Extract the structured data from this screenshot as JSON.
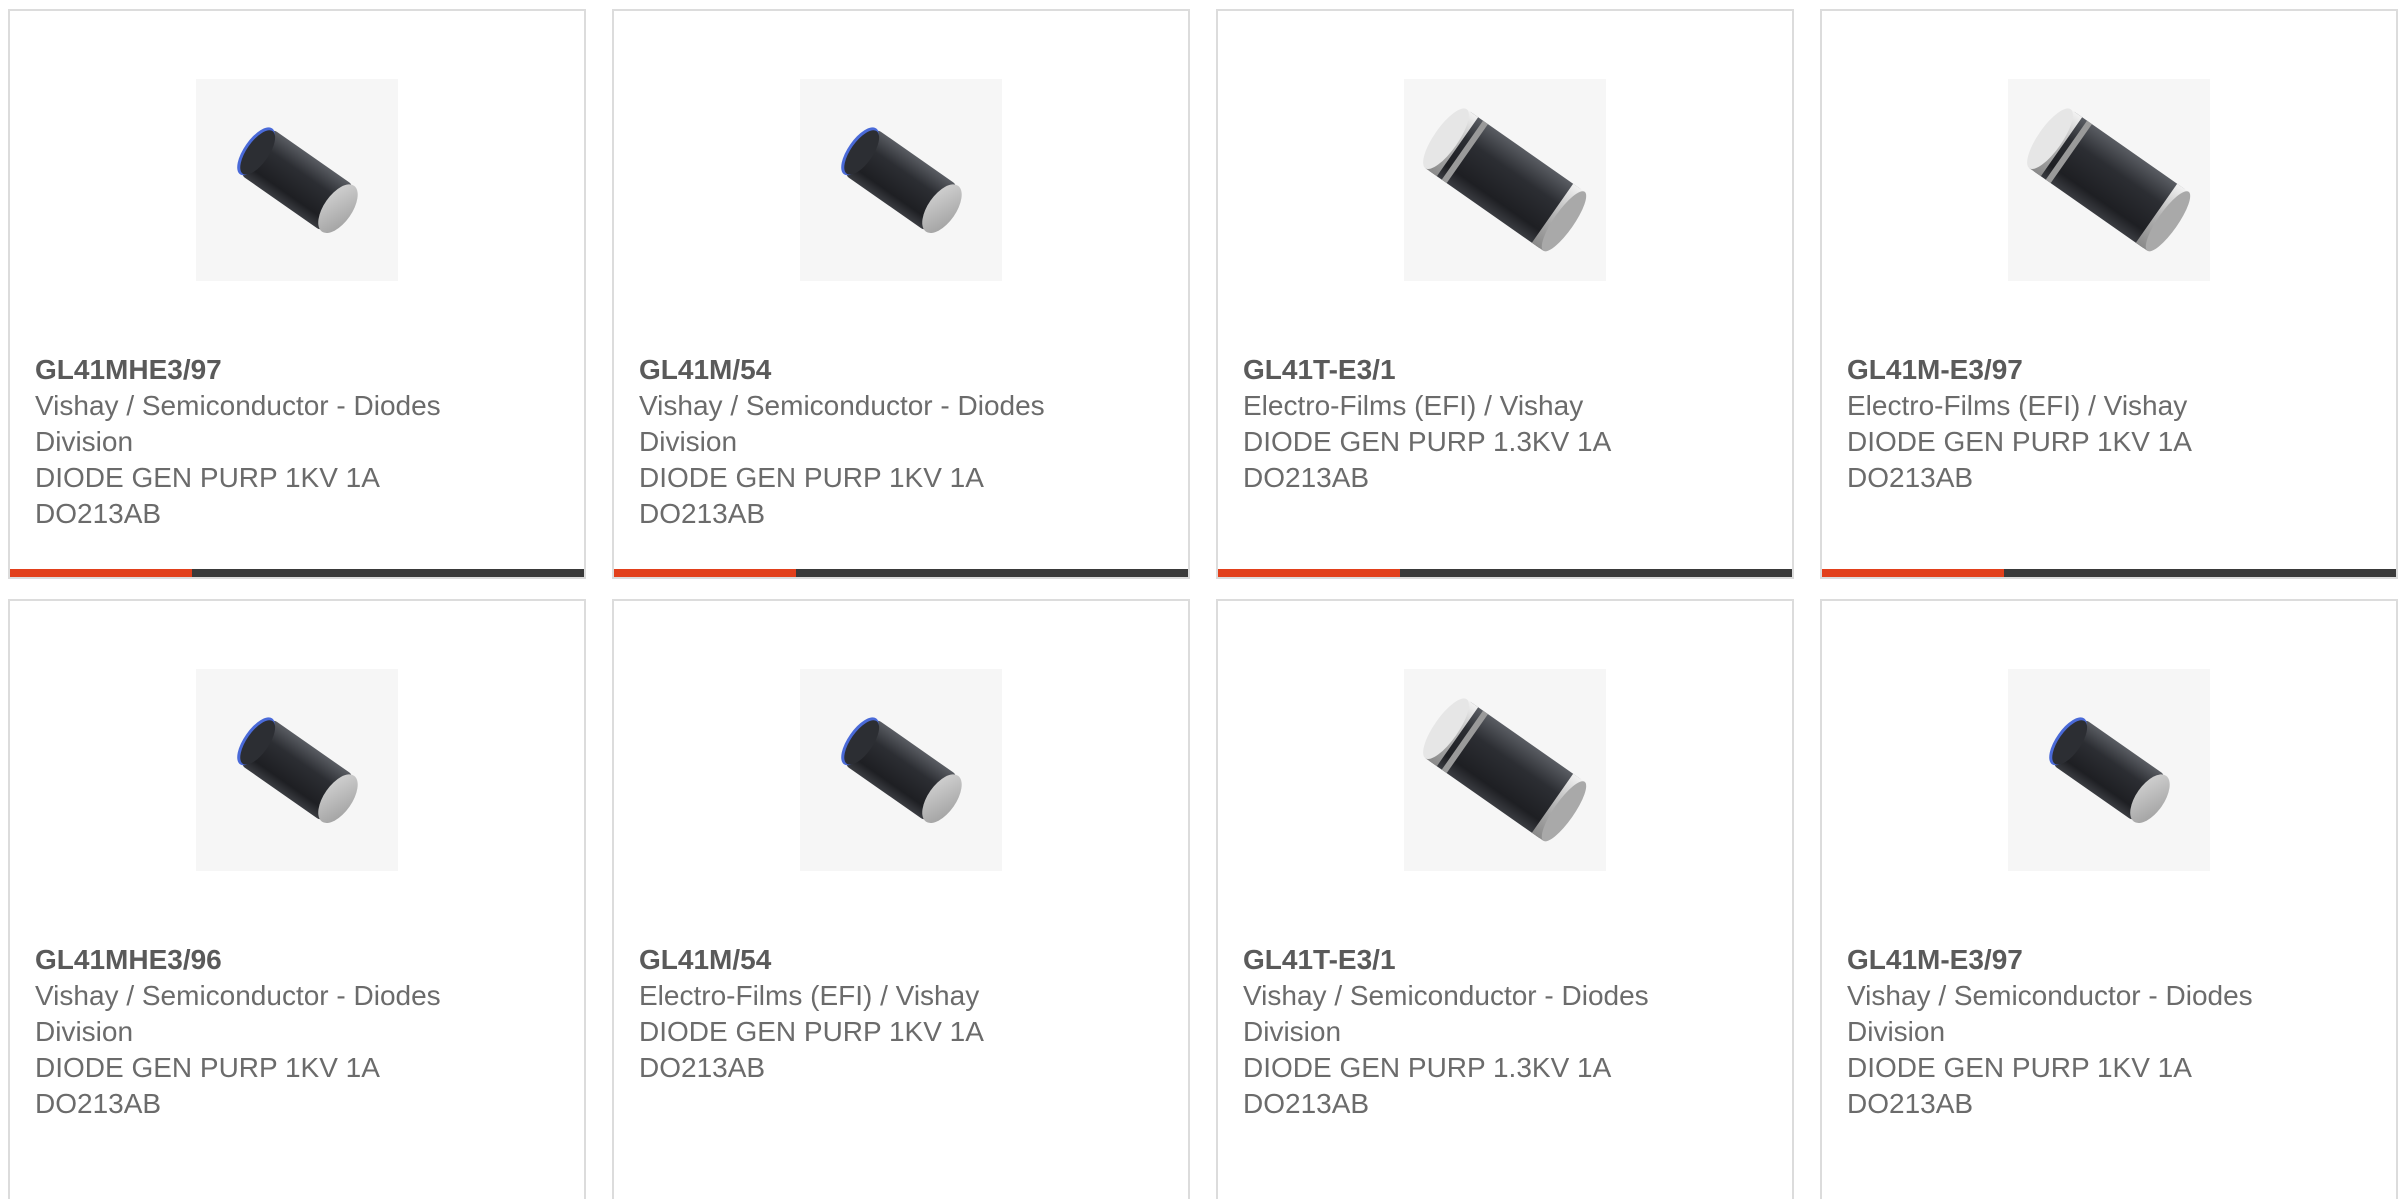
{
  "colors": {
    "accent": "#e2401c",
    "bar": "#3a3a3a",
    "text": "#6b6b6b",
    "border": "#dcdcdc"
  },
  "products": [
    {
      "part": "GL41MHE3/97",
      "manufacturer": "Vishay / Semiconductor - Diodes Division",
      "description": "DIODE GEN PURP 1KV 1A DO213AB",
      "image_icon": "melf-diode-small-icon"
    },
    {
      "part": "GL41M/54",
      "manufacturer": "Vishay / Semiconductor - Diodes Division",
      "description": "DIODE GEN PURP 1KV 1A DO213AB",
      "image_icon": "melf-diode-small-icon"
    },
    {
      "part": "GL41T-E3/1",
      "manufacturer": "Electro-Films (EFI) / Vishay",
      "description": "DIODE GEN PURP 1.3KV 1A DO213AB",
      "image_icon": "melf-diode-large-icon"
    },
    {
      "part": "GL41M-E3/97",
      "manufacturer": "Electro-Films (EFI) / Vishay",
      "description": "DIODE GEN PURP 1KV 1A DO213AB",
      "image_icon": "melf-diode-large-icon"
    },
    {
      "part": "GL41MHE3/96",
      "manufacturer": "Vishay / Semiconductor - Diodes Division",
      "description": "DIODE GEN PURP 1KV 1A DO213AB",
      "image_icon": "melf-diode-small-icon"
    },
    {
      "part": "GL41M/54",
      "manufacturer": "Electro-Films (EFI) / Vishay",
      "description": "DIODE GEN PURP 1KV 1A DO213AB",
      "image_icon": "melf-diode-small-icon"
    },
    {
      "part": "GL41T-E3/1",
      "manufacturer": "Vishay / Semiconductor - Diodes Division",
      "description": "DIODE GEN PURP 1.3KV 1A DO213AB",
      "image_icon": "melf-diode-large-icon"
    },
    {
      "part": "GL41M-E3/97",
      "manufacturer": "Vishay / Semiconductor - Diodes Division",
      "description": "DIODE GEN PURP 1KV 1A DO213AB",
      "image_icon": "melf-diode-small-icon"
    }
  ]
}
